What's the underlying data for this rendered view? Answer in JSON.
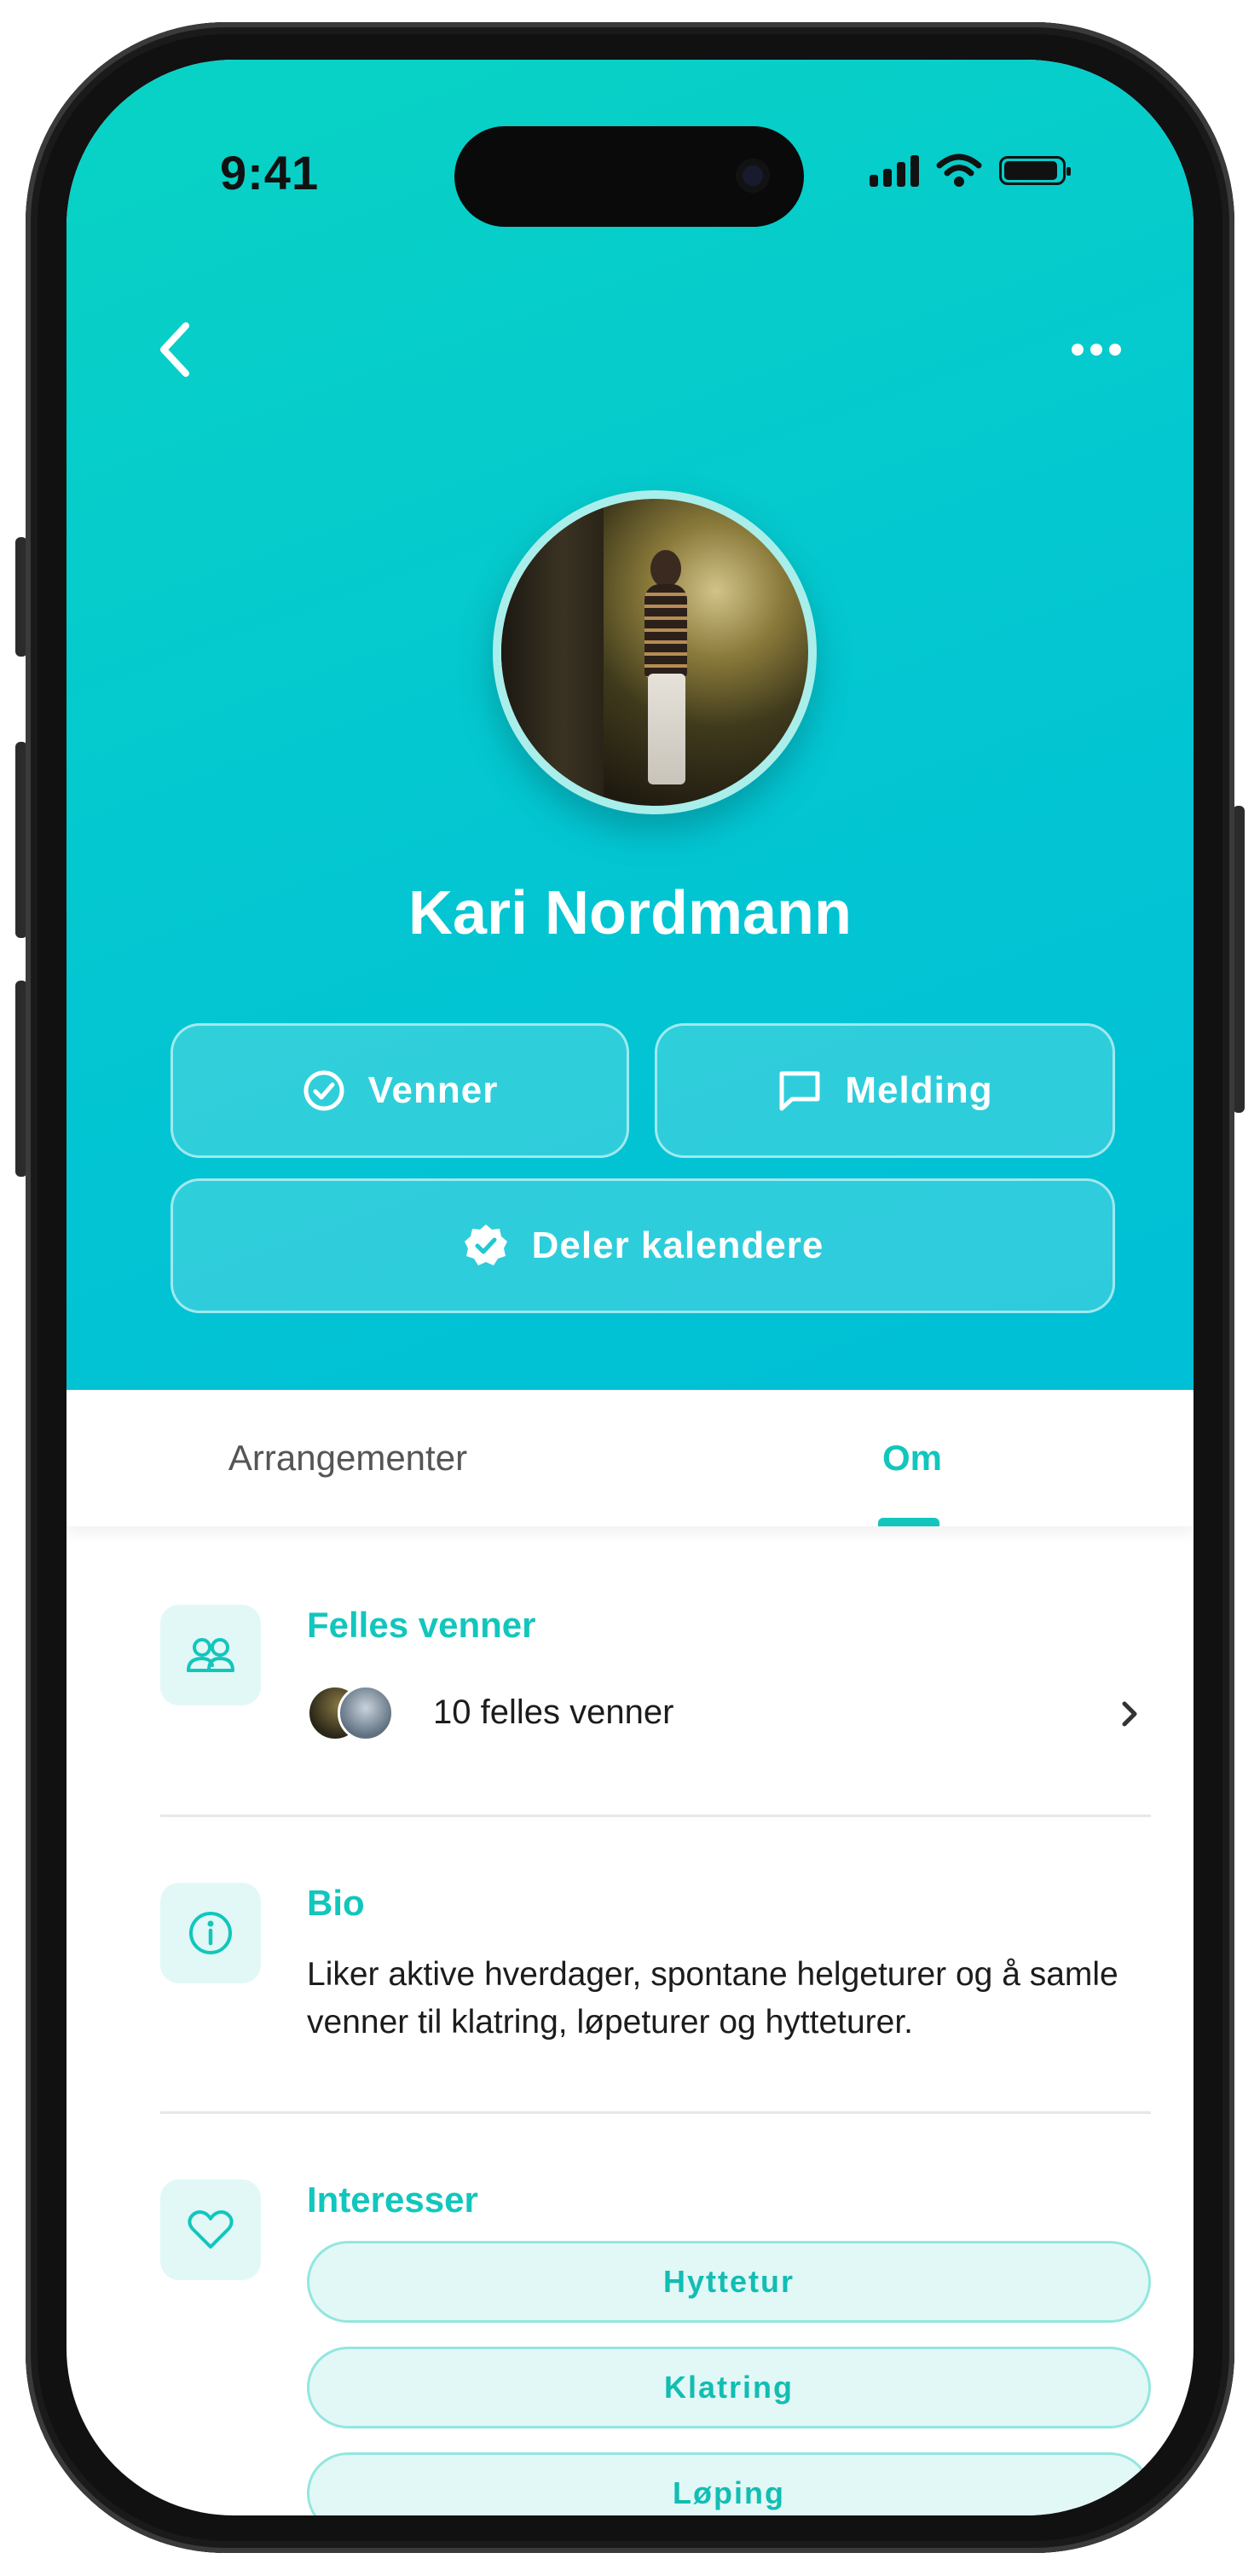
{
  "status_bar": {
    "time": "9:41"
  },
  "header": {
    "back_icon": "chevron-left-icon",
    "more_icon": "more-horizontal-icon"
  },
  "profile": {
    "name": "Kari Nordmann",
    "avatar_alt": "profile-photo"
  },
  "actions": {
    "friends_label": "Venner",
    "message_label": "Melding",
    "calendar_label": "Deler kalendere"
  },
  "tabs": [
    {
      "label": "Arrangementer",
      "active": false
    },
    {
      "label": "Om",
      "active": true
    }
  ],
  "mutual_friends": {
    "title": "Felles venner",
    "text": "10 felles venner"
  },
  "bio": {
    "title": "Bio",
    "text": "Liker aktive hverdager, spontane helgeturer og å samle venner til klatring, løpeturer og hytteturer."
  },
  "interests": {
    "title": "Interesser",
    "items": [
      "Hyttetur",
      "Klatring",
      "Løping"
    ]
  },
  "colors": {
    "accent": "#12c6bd",
    "header_gradient_start": "#09d3c4",
    "header_gradient_end": "#00bfd6",
    "chip_bg": "#e1f8f6"
  }
}
